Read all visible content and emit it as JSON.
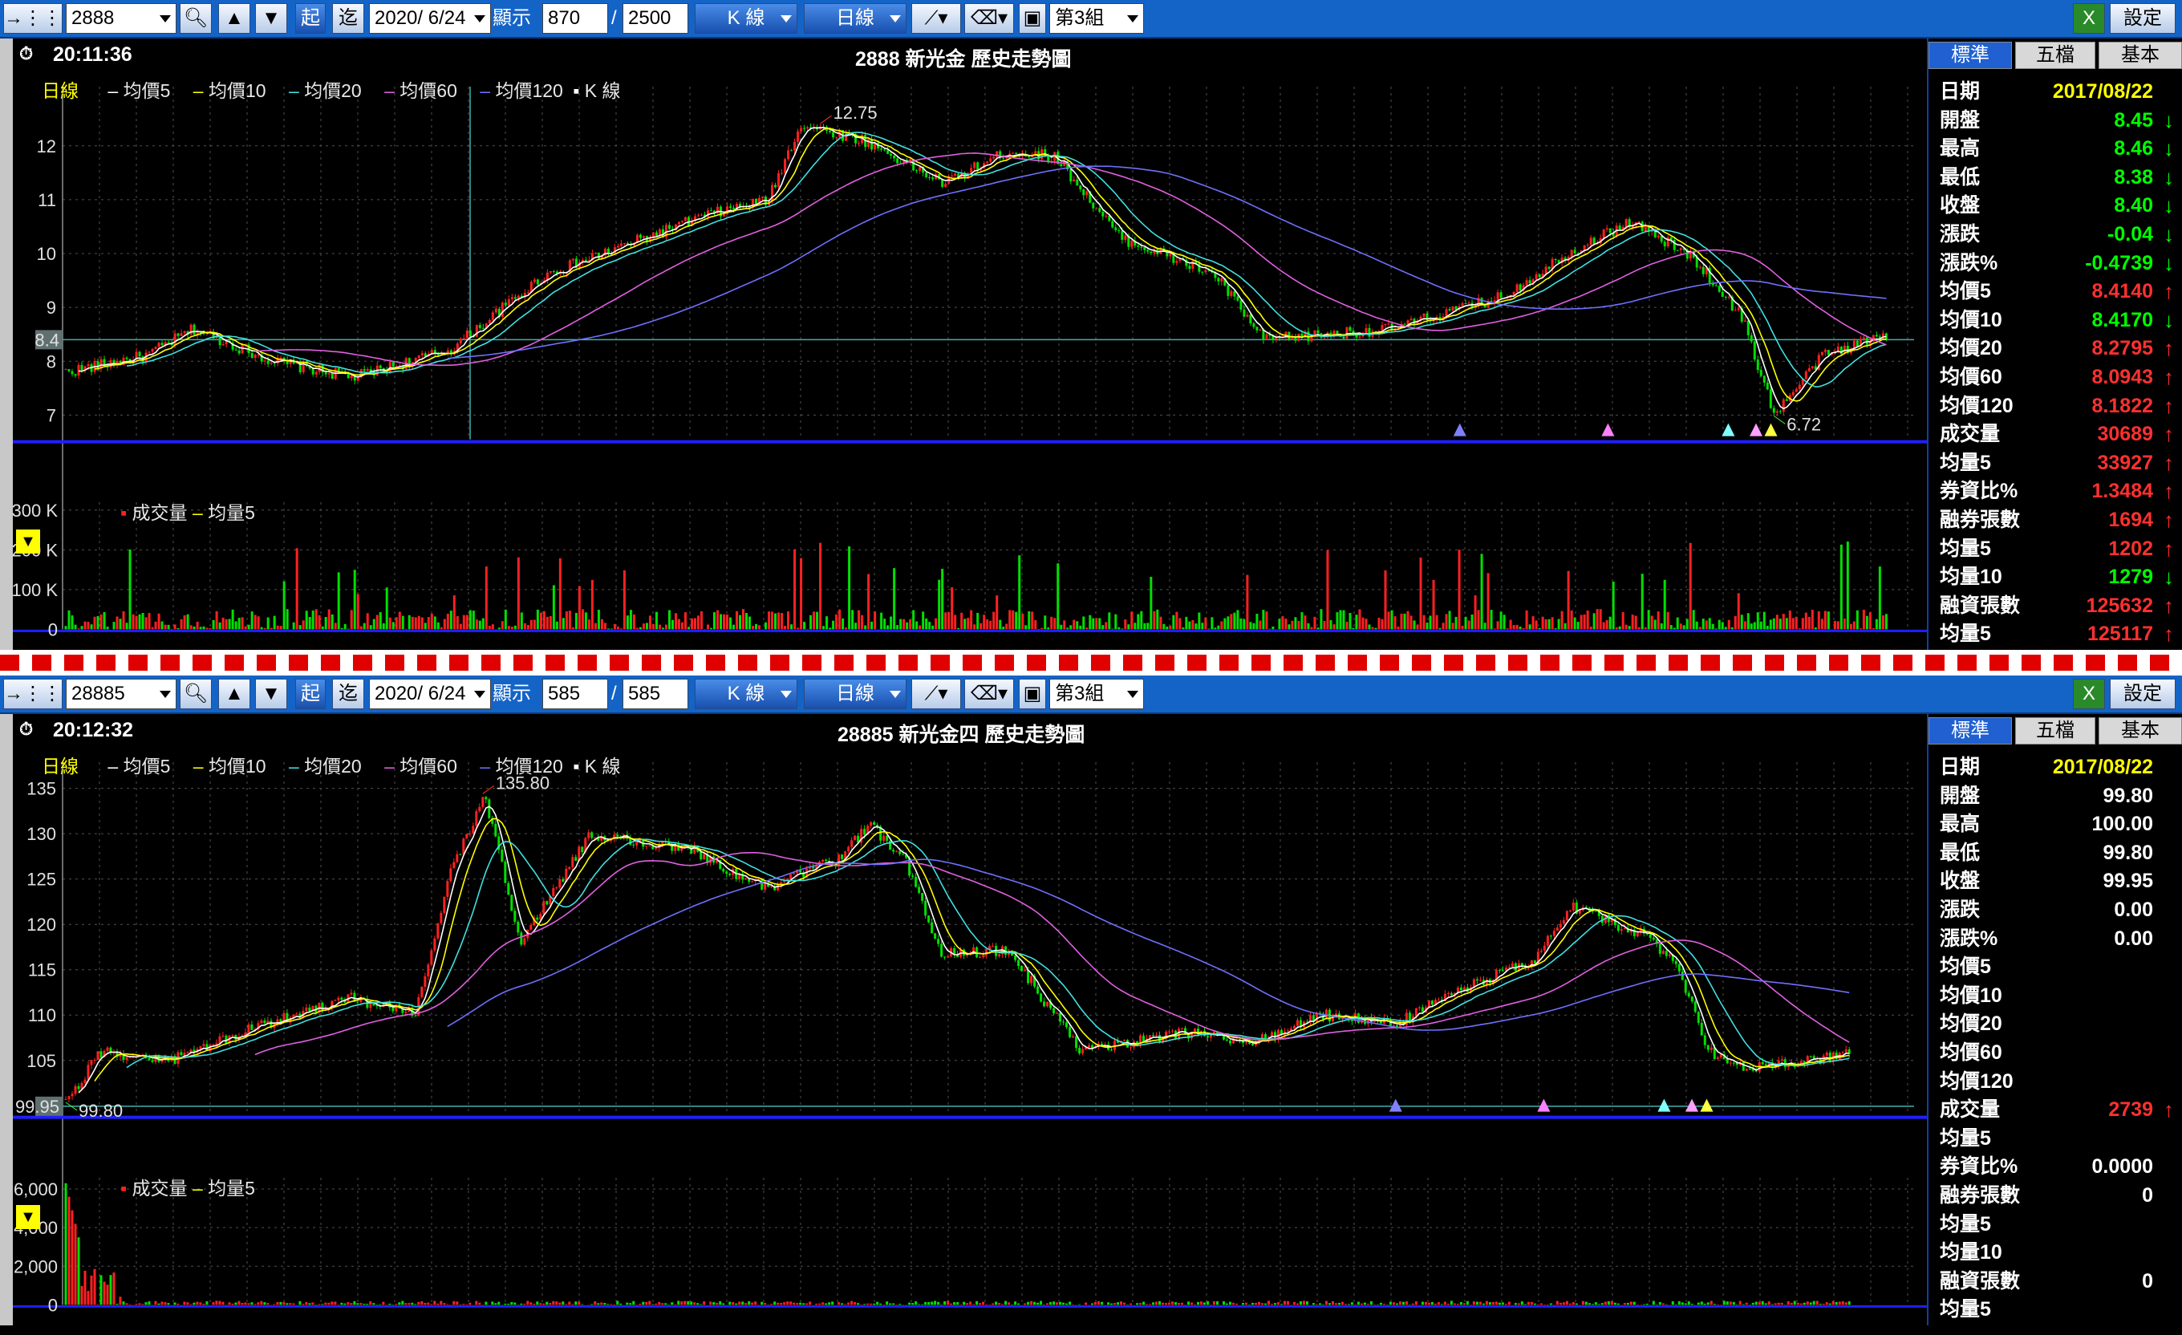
{
  "toolbar_labels": {
    "start": "起",
    "end": "迄",
    "display": "顯示",
    "slash": "/",
    "kline": "K 線",
    "daily": "日線",
    "group": "第3組",
    "settings": "設定"
  },
  "panes": [
    {
      "id": "top",
      "toolbar": {
        "symbol": "2888",
        "date": "2020/ 6/24",
        "display": "870",
        "total": "2500"
      },
      "time": "20:11:36",
      "title": "2888 新光金 歷史走勢圖",
      "legend": {
        "period": "日線",
        "ma5": "均價5",
        "ma10": "均價10",
        "ma20": "均價20",
        "ma60": "均價60",
        "ma120": "均價120",
        "k": "K 線"
      },
      "volume_legend": {
        "vol": "成交量",
        "ma5": "均量5"
      },
      "y_ticks": [
        "12",
        "11",
        "10",
        "9",
        "8",
        "7"
      ],
      "y_tick_values": [
        12,
        11,
        10,
        9,
        8,
        7
      ],
      "y_range": [
        6.55,
        12.95
      ],
      "price_marker": "8.4",
      "price_marker_value": 8.4,
      "high_label": "12.75",
      "low_label": "6.72",
      "vol_ticks": [
        "300 K",
        "200 K",
        "100 K",
        "0"
      ],
      "vol_tick_values": [
        300,
        200,
        100,
        0
      ],
      "vol_max": 340,
      "vol_scale": 1,
      "series_seed": {
        "start": 7.6,
        "path": [
          [
            0,
            7.8
          ],
          [
            0.05,
            8.1
          ],
          [
            0.08,
            8.6
          ],
          [
            0.13,
            8.0
          ],
          [
            0.18,
            7.7
          ],
          [
            0.24,
            8.2
          ],
          [
            0.3,
            9.6
          ],
          [
            0.4,
            10.7
          ],
          [
            0.44,
            11.0
          ],
          [
            0.46,
            12.4
          ],
          [
            0.5,
            12.1
          ],
          [
            0.55,
            11.3
          ],
          [
            0.59,
            11.9
          ],
          [
            0.62,
            11.8
          ],
          [
            0.66,
            10.3
          ],
          [
            0.72,
            9.6
          ],
          [
            0.75,
            8.4
          ],
          [
            0.83,
            8.6
          ],
          [
            0.9,
            9.2
          ],
          [
            0.94,
            10.0
          ],
          [
            0.98,
            10.6
          ],
          [
            1.02,
            9.9
          ],
          [
            1.05,
            8.8
          ],
          [
            1.07,
            7.0
          ],
          [
            1.1,
            8.1
          ],
          [
            1.14,
            8.5
          ]
        ],
        "x_end": 0.985
      },
      "tabs": [
        "標準",
        "五檔",
        "基本"
      ],
      "rows": [
        {
          "k": "日期",
          "v": "2017/08/22",
          "c": "#ffff00",
          "a": ""
        },
        {
          "k": "開盤",
          "v": "8.45",
          "c": "#00ff00",
          "a": "↓"
        },
        {
          "k": "最高",
          "v": "8.46",
          "c": "#00ff00",
          "a": "↓"
        },
        {
          "k": "最低",
          "v": "8.38",
          "c": "#00ff00",
          "a": "↓"
        },
        {
          "k": "收盤",
          "v": "8.40",
          "c": "#00ff00",
          "a": "↓"
        },
        {
          "k": "漲跌",
          "v": "-0.04",
          "c": "#00ff00",
          "a": "↓"
        },
        {
          "k": "漲跌%",
          "v": "-0.4739",
          "c": "#00ff00",
          "a": "↓"
        },
        {
          "k": "均價5",
          "v": "8.4140",
          "c": "#ff3030",
          "a": "↑"
        },
        {
          "k": "均價10",
          "v": "8.4170",
          "c": "#00ff00",
          "a": "↓"
        },
        {
          "k": "均價20",
          "v": "8.2795",
          "c": "#ff3030",
          "a": "↑"
        },
        {
          "k": "均價60",
          "v": "8.0943",
          "c": "#ff3030",
          "a": "↑"
        },
        {
          "k": "均價120",
          "v": "8.1822",
          "c": "#ff3030",
          "a": "↑"
        },
        {
          "k": "成交量",
          "v": "30689",
          "c": "#ff3030",
          "a": "↑"
        },
        {
          "k": "均量5",
          "v": "33927",
          "c": "#ff3030",
          "a": "↑"
        },
        {
          "k": "券資比%",
          "v": "1.3484",
          "c": "#ff3030",
          "a": "↑"
        },
        {
          "k": "融券張數",
          "v": "1694",
          "c": "#ff3030",
          "a": "↑"
        },
        {
          "k": "均量5",
          "v": "1202",
          "c": "#ff3030",
          "a": "↑"
        },
        {
          "k": "均量10",
          "v": "1279",
          "c": "#00ff00",
          "a": "↓"
        },
        {
          "k": "融資張數",
          "v": "125632",
          "c": "#ff3030",
          "a": "↑"
        },
        {
          "k": "均量5",
          "v": "125117",
          "c": "#ff3030",
          "a": "↑"
        }
      ]
    },
    {
      "id": "bottom",
      "toolbar": {
        "symbol": "28885",
        "date": "2020/ 6/24",
        "display": "585",
        "total": "585"
      },
      "time": "20:12:32",
      "title": "28885 新光金四 歷史走勢圖",
      "legend": {
        "period": "日線",
        "ma5": "均價5",
        "ma10": "均價10",
        "ma20": "均價20",
        "ma60": "均價60",
        "ma120": "均價120",
        "k": "K 線"
      },
      "volume_legend": {
        "vol": "成交量",
        "ma5": "均量5"
      },
      "y_ticks": [
        "135",
        "130",
        "125",
        "120",
        "115",
        "110",
        "105"
      ],
      "y_tick_values": [
        135,
        130,
        125,
        120,
        115,
        110,
        105
      ],
      "y_range": [
        99.0,
        137.0
      ],
      "price_marker": "99.95",
      "price_marker_value": 99.95,
      "high_label": "135.80",
      "low_label": "99.80",
      "vol_ticks": [
        "6,000",
        "4,000",
        "2,000",
        "0"
      ],
      "vol_tick_values": [
        6000,
        4000,
        2000,
        0
      ],
      "vol_max": 7000,
      "vol_scale": 2,
      "series_seed": {
        "path": [
          [
            0,
            100.2
          ],
          [
            0.02,
            106
          ],
          [
            0.06,
            105
          ],
          [
            0.1,
            108
          ],
          [
            0.16,
            112
          ],
          [
            0.2,
            110
          ],
          [
            0.22,
            126
          ],
          [
            0.24,
            134
          ],
          [
            0.26,
            118
          ],
          [
            0.3,
            130
          ],
          [
            0.36,
            128
          ],
          [
            0.4,
            124
          ],
          [
            0.44,
            127
          ],
          [
            0.46,
            131
          ],
          [
            0.48,
            127
          ],
          [
            0.5,
            117
          ],
          [
            0.54,
            117
          ],
          [
            0.58,
            106
          ],
          [
            0.64,
            108
          ],
          [
            0.68,
            107
          ],
          [
            0.72,
            110
          ],
          [
            0.76,
            109
          ],
          [
            0.8,
            113
          ],
          [
            0.84,
            116
          ],
          [
            0.86,
            122
          ],
          [
            0.9,
            119
          ],
          [
            0.92,
            116
          ],
          [
            0.94,
            106
          ],
          [
            0.96,
            104
          ],
          [
            1.0,
            105
          ],
          [
            1.02,
            106
          ]
        ],
        "x_end": 0.965
      },
      "tabs": [
        "標準",
        "五檔",
        "基本"
      ],
      "rows": [
        {
          "k": "日期",
          "v": "2017/08/22",
          "c": "#ffff00",
          "a": ""
        },
        {
          "k": "開盤",
          "v": "99.80",
          "c": "#ffffff",
          "a": ""
        },
        {
          "k": "最高",
          "v": "100.00",
          "c": "#ffffff",
          "a": ""
        },
        {
          "k": "最低",
          "v": "99.80",
          "c": "#ffffff",
          "a": ""
        },
        {
          "k": "收盤",
          "v": "99.95",
          "c": "#ffffff",
          "a": ""
        },
        {
          "k": "漲跌",
          "v": "0.00",
          "c": "#ffffff",
          "a": ""
        },
        {
          "k": "漲跌%",
          "v": "0.00",
          "c": "#ffffff",
          "a": ""
        },
        {
          "k": "均價5",
          "v": "",
          "c": "#ffffff",
          "a": ""
        },
        {
          "k": "均價10",
          "v": "",
          "c": "#ffffff",
          "a": ""
        },
        {
          "k": "均價20",
          "v": "",
          "c": "#ffffff",
          "a": ""
        },
        {
          "k": "均價60",
          "v": "",
          "c": "#ffffff",
          "a": ""
        },
        {
          "k": "均價120",
          "v": "",
          "c": "#ffffff",
          "a": ""
        },
        {
          "k": "成交量",
          "v": "2739",
          "c": "#ff3030",
          "a": "↑"
        },
        {
          "k": "均量5",
          "v": "",
          "c": "#ffffff",
          "a": ""
        },
        {
          "k": "券資比%",
          "v": "0.0000",
          "c": "#ffffff",
          "a": ""
        },
        {
          "k": "融券張數",
          "v": "0",
          "c": "#ffffff",
          "a": ""
        },
        {
          "k": "均量5",
          "v": "",
          "c": "#ffffff",
          "a": ""
        },
        {
          "k": "均量10",
          "v": "",
          "c": "#ffffff",
          "a": ""
        },
        {
          "k": "融資張數",
          "v": "0",
          "c": "#ffffff",
          "a": ""
        },
        {
          "k": "均量5",
          "v": "",
          "c": "#ffffff",
          "a": ""
        }
      ]
    }
  ],
  "colors": {
    "ma5": "#ffffff",
    "ma10": "#ffff00",
    "ma20": "#40e0e0",
    "ma60": "#e060e0",
    "ma120": "#7070ff",
    "up": "#ff2020",
    "down": "#00e000",
    "grid": "#505050",
    "axis": "#2020ff"
  }
}
